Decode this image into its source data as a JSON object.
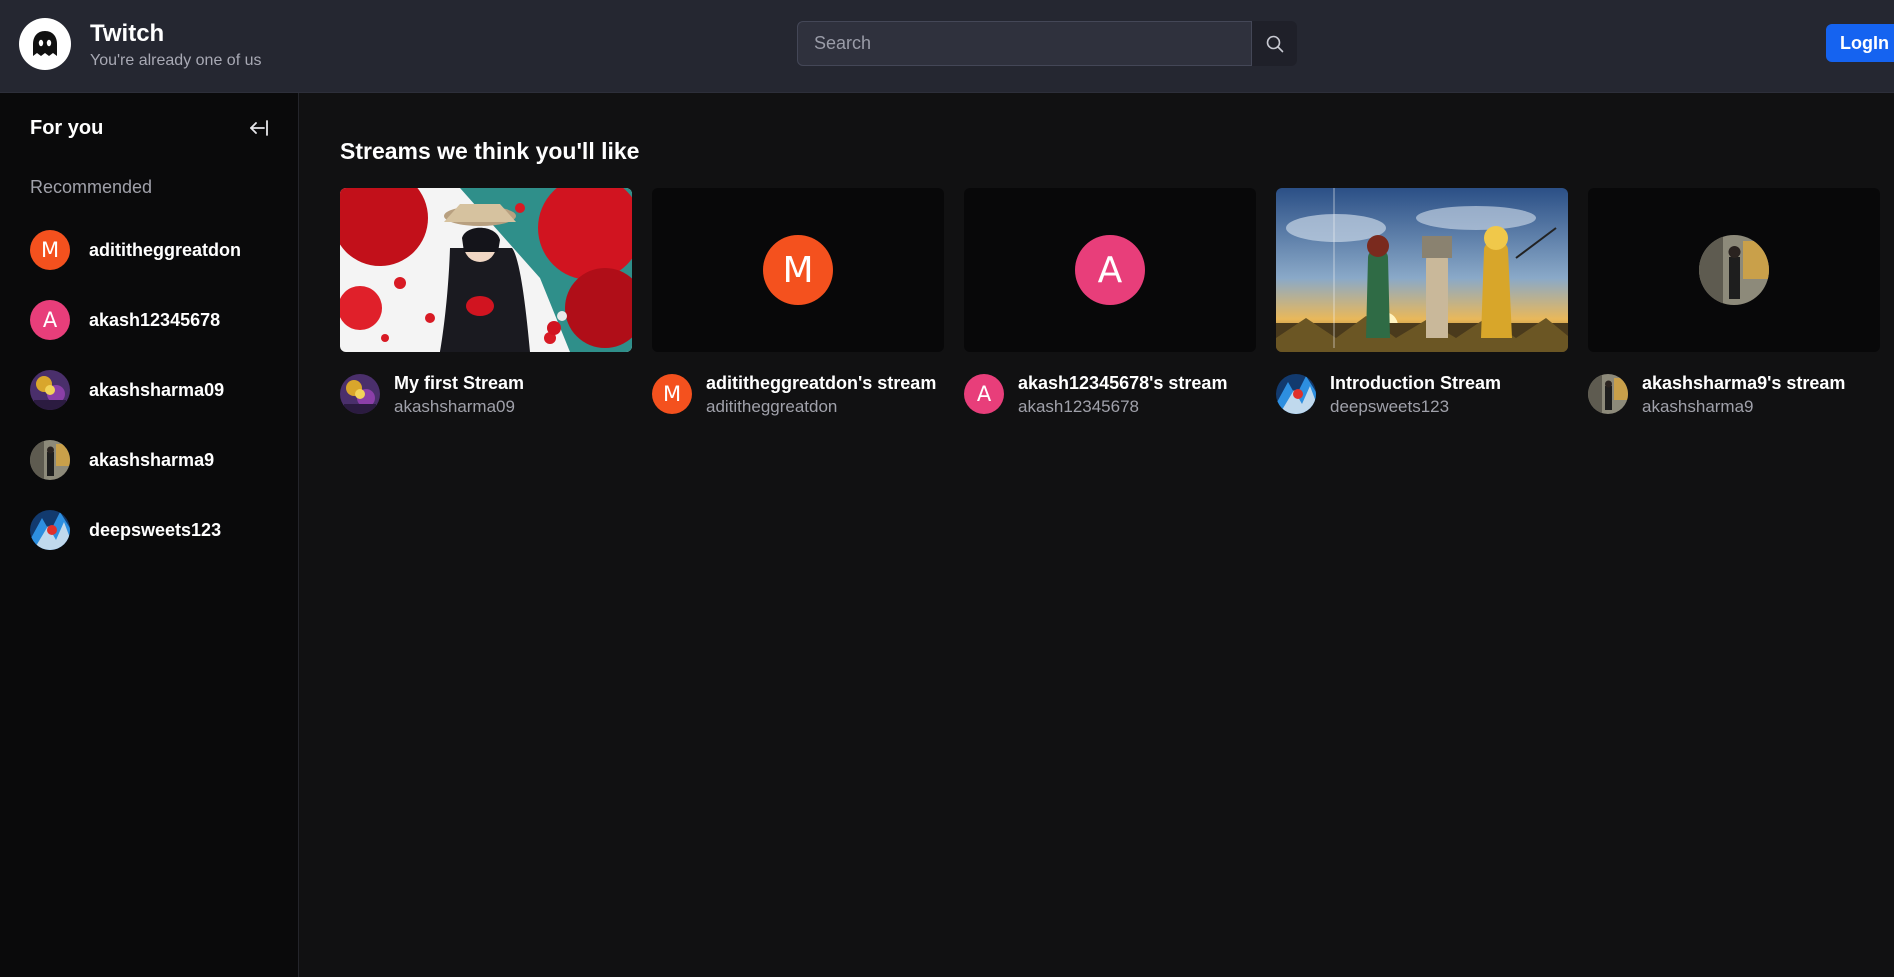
{
  "header": {
    "title": "Twitch",
    "subtitle": "You're already one of us",
    "search_placeholder": "Search",
    "login_label": "LogIn",
    "logo_icon": "ghost-icon",
    "search_icon": "search-icon"
  },
  "sidebar": {
    "heading": "For you",
    "collapse_icon": "arrow-left-to-line-icon",
    "section_label": "Recommended",
    "items": [
      {
        "name": "adititheggreatdon",
        "avatar_letter": "M",
        "avatar_color": "#f4511e"
      },
      {
        "name": "akash12345678",
        "avatar_letter": "A",
        "avatar_color": "#e83e7a"
      },
      {
        "name": "akashsharma09",
        "avatar_letter": "",
        "avatar_color": "#5a3a7a"
      },
      {
        "name": "akashsharma9",
        "avatar_letter": "",
        "avatar_color": "#8a7a4a"
      },
      {
        "name": "deepsweets123",
        "avatar_letter": "",
        "avatar_color": "#2a6fd1"
      }
    ]
  },
  "main": {
    "title": "Streams we think you'll like",
    "streams": [
      {
        "title": "My first Stream",
        "user": "akashsharma09",
        "thumbnail": "image",
        "avatar_letter": ""
      },
      {
        "title": "adititheggreatdon's stream",
        "user": "adititheggreatdon",
        "thumbnail": "avatar",
        "avatar_letter": "M",
        "avatar_color": "#f4511e"
      },
      {
        "title": "akash12345678's stream",
        "user": "akash12345678",
        "thumbnail": "avatar",
        "avatar_letter": "A",
        "avatar_color": "#e83e7a"
      },
      {
        "title": "Introduction Stream",
        "user": "deepsweets123",
        "thumbnail": "image",
        "avatar_letter": ""
      },
      {
        "title": "akashsharma9's stream",
        "user": "akashsharma9",
        "thumbnail": "avatar-photo",
        "avatar_letter": ""
      }
    ]
  }
}
